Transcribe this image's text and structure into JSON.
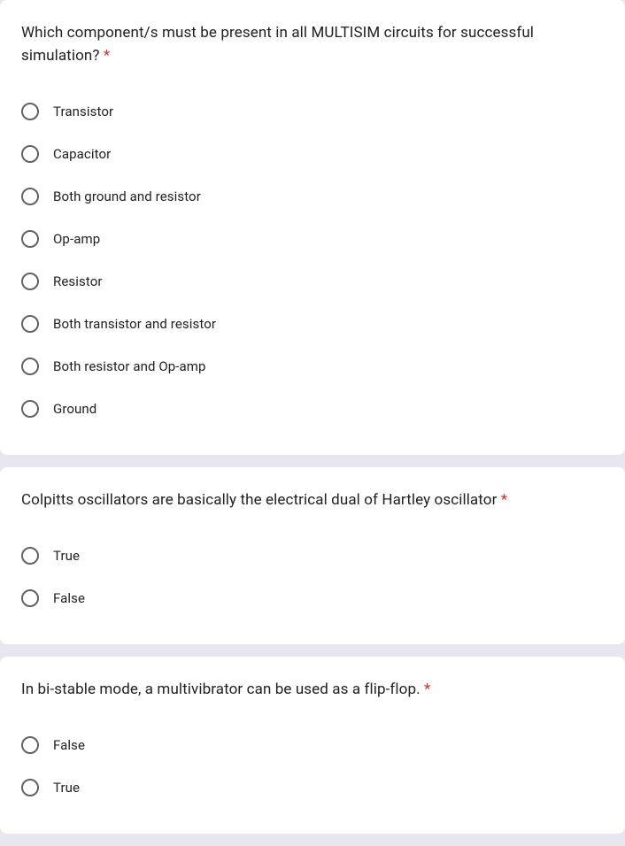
{
  "required_mark": "*",
  "questions": [
    {
      "text": "Which component/s must be present in all MULTISIM circuits for successful simulation?",
      "required": true,
      "options": [
        "Transistor",
        "Capacitor",
        "Both ground and resistor",
        "Op-amp",
        "Resistor",
        "Both transistor and resistor",
        "Both resistor and Op-amp",
        "Ground"
      ]
    },
    {
      "text": "Colpitts oscillators are basically the electrical dual of Hartley oscillator",
      "required": true,
      "options": [
        "True",
        "False"
      ]
    },
    {
      "text": "In bi-stable mode, a multivibrator can be used as a flip-flop.",
      "required": true,
      "options": [
        "False",
        "True"
      ]
    }
  ]
}
